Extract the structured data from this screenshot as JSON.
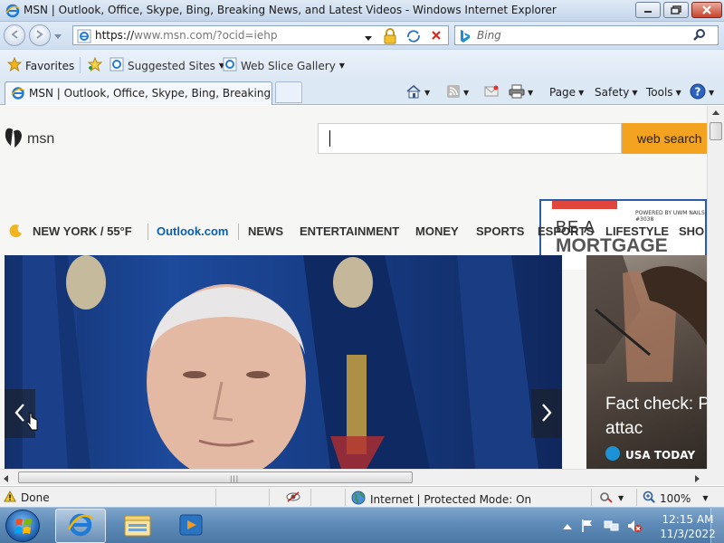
{
  "window": {
    "title": "MSN | Outlook, Office, Skype, Bing, Breaking News, and Latest Videos - Windows Internet Explorer"
  },
  "address": {
    "url_main": "https://",
    "url_host": "www.msn.com/",
    "url_query": "?ocid=iehp"
  },
  "bing": {
    "placeholder": "Bing"
  },
  "favorites_bar": {
    "favorites": "Favorites",
    "suggested": "Suggested Sites",
    "webslice": "Web Slice Gallery"
  },
  "tabs": [
    {
      "title": "MSN | Outlook, Office, Skype, Bing, Breaking Ne..."
    }
  ],
  "commands": {
    "page": "Page",
    "safety": "Safety",
    "tools": "Tools"
  },
  "msn": {
    "logo_text": "msn",
    "search_button": "web search",
    "weather": "NEW YORK / 55°F",
    "nav": [
      "Outlook.com",
      "NEWS",
      "ENTERTAINMENT",
      "MONEY",
      "SPORTS",
      "ESPORTS",
      "LIFESTYLE",
      "SHO"
    ]
  },
  "ad": {
    "line1": "BE A",
    "line2": "MORTGAGE",
    "powered": "POWERED BY UWM NAILS #3038"
  },
  "side_card": {
    "title": "Fact check: Pa alleged attac",
    "source": "USA TODAY"
  },
  "status": {
    "text": "Done",
    "zone": "Internet | Protected Mode: On",
    "zoom": "100%"
  },
  "clock": {
    "time": "12:15 AM",
    "date": "11/3/2022"
  },
  "colors": {
    "accent_orange": "#f3a31f",
    "outlook_blue": "#0a5fa8",
    "ad_border": "#2b5ca5"
  },
  "icons": [
    "ie-icon",
    "back-arrow-icon",
    "forward-arrow-icon",
    "lock-icon",
    "compat-view-icon",
    "stop-icon",
    "bing-icon",
    "search-icon",
    "favorites-star-icon",
    "home-icon",
    "feeds-icon",
    "mail-icon",
    "print-icon",
    "help-icon",
    "moon-icon",
    "warning-icon",
    "zoom-icon",
    "globe-icon"
  ]
}
